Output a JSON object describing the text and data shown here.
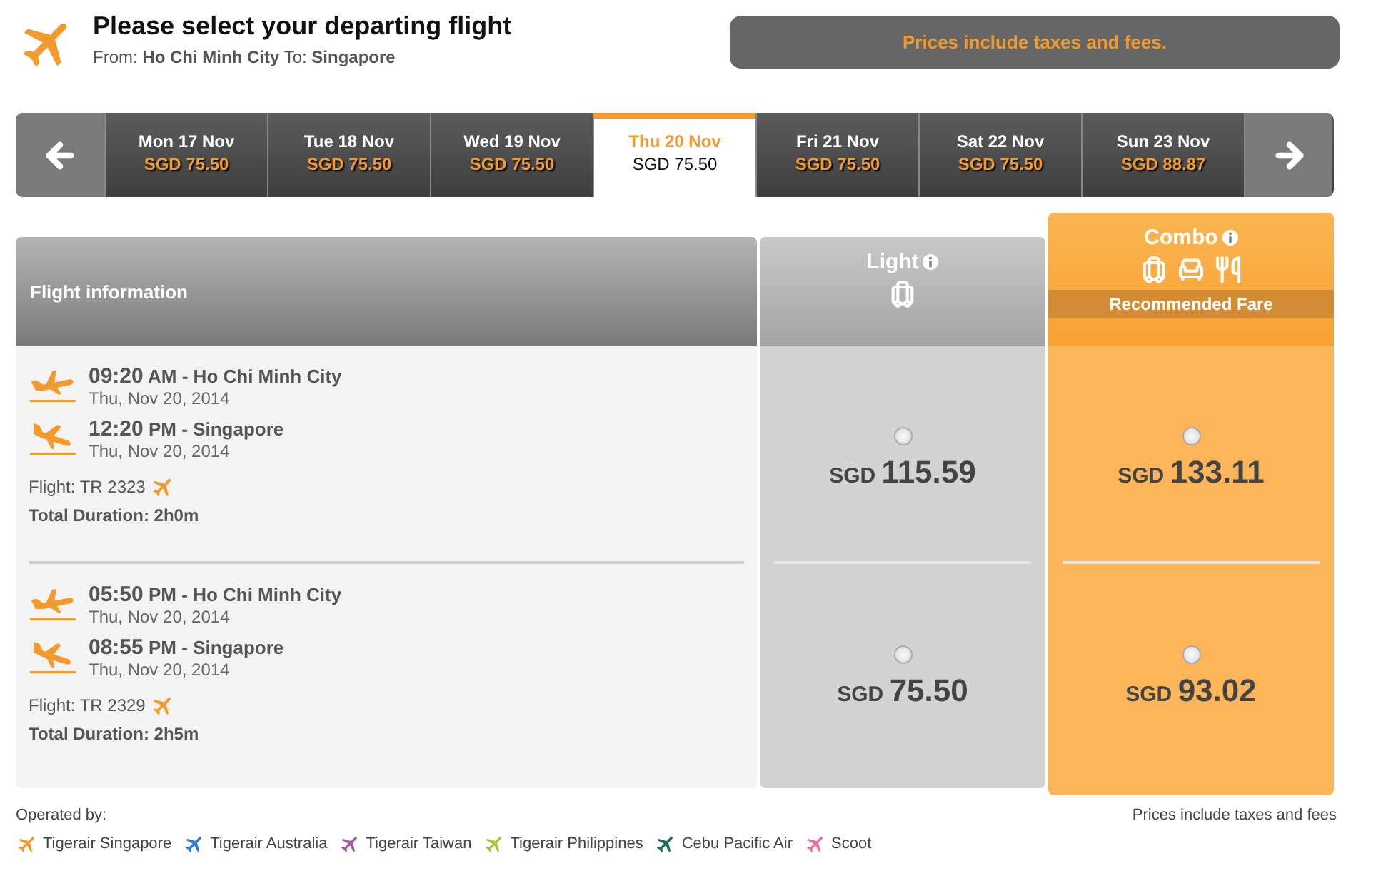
{
  "header": {
    "title": "Please select your departing flight",
    "route": [
      {
        "label": "From:",
        "value": "Ho Chi Minh City"
      },
      {
        "label": "To:",
        "value": "Singapore"
      }
    ]
  },
  "notice": "Prices include taxes and fees.",
  "dates": [
    {
      "day": "Mon 17 Nov",
      "price": "SGD 75.50",
      "selected": false
    },
    {
      "day": "Tue 18 Nov",
      "price": "SGD 75.50",
      "selected": false
    },
    {
      "day": "Wed 19 Nov",
      "price": "SGD 75.50",
      "selected": false
    },
    {
      "day": "Thu 20 Nov",
      "price": "SGD 75.50",
      "selected": true
    },
    {
      "day": "Fri 21 Nov",
      "price": "SGD 75.50",
      "selected": false
    },
    {
      "day": "Sat 22 Nov",
      "price": "SGD 75.50",
      "selected": false
    },
    {
      "day": "Sun 23 Nov",
      "price": "SGD 88.87",
      "selected": false
    }
  ],
  "table": {
    "info_heading": "Flight information",
    "fare_columns": [
      {
        "kind": "light",
        "name": "Light"
      },
      {
        "kind": "combo",
        "name": "Combo",
        "badge": "Recommended Fare"
      }
    ],
    "flights": [
      {
        "segments": [
          {
            "kind": "departure",
            "time": "09:20",
            "period": "AM",
            "place": "- Ho Chi Minh City",
            "date": "Thu, Nov 20, 2014"
          },
          {
            "kind": "arrival",
            "time": "12:20",
            "period": "PM",
            "place": "- Singapore",
            "date": "Thu, Nov 20, 2014"
          }
        ],
        "flight_label": "Flight:",
        "flight_number": "TR 2323",
        "duration": "Total Duration: 2h0m",
        "fares": [
          {
            "currency": "SGD",
            "amount": "115.59",
            "selected": false
          },
          {
            "currency": "SGD",
            "amount": "133.11",
            "selected": false
          }
        ]
      },
      {
        "segments": [
          {
            "kind": "departure",
            "time": "05:50",
            "period": "PM",
            "place": "- Ho Chi Minh City",
            "date": "Thu, Nov 20, 2014"
          },
          {
            "kind": "arrival",
            "time": "08:55",
            "period": "PM",
            "place": "- Singapore",
            "date": "Thu, Nov 20, 2014"
          }
        ],
        "flight_label": "Flight:",
        "flight_number": "TR 2329",
        "duration": "Total Duration: 2h5m",
        "fares": [
          {
            "currency": "SGD",
            "amount": "75.50",
            "selected": false
          },
          {
            "currency": "SGD",
            "amount": "93.02",
            "selected": false
          }
        ]
      }
    ]
  },
  "footer": {
    "operated_by": "Operated by:",
    "note": "Prices include taxes and fees",
    "airlines": [
      {
        "name": "Tigerair Singapore",
        "color": "#f29b2c"
      },
      {
        "name": "Tigerair Australia",
        "color": "#2f7ad6"
      },
      {
        "name": "Tigerair Taiwan",
        "color": "#a05aa8"
      },
      {
        "name": "Tigerair Philippines",
        "color": "#a8c43a"
      },
      {
        "name": "Cebu Pacific Air",
        "color": "#1f6b5a"
      },
      {
        "name": "Scoot",
        "color": "#f06ba0"
      }
    ]
  }
}
